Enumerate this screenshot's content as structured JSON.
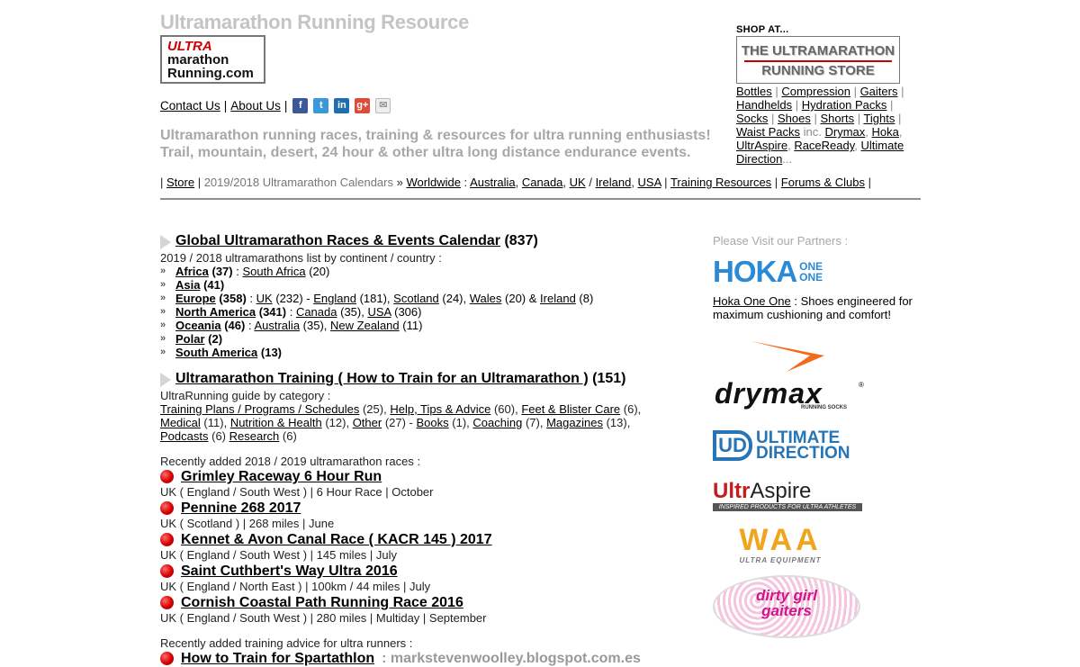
{
  "header": {
    "site_title": "Ultramarathon Running Resource",
    "logo": {
      "line1": "ULTRA",
      "line2": "marathon",
      "line3": "Running.com"
    },
    "contact": "Contact Us",
    "about": "About Us",
    "sep": "|",
    "social": {
      "fb": "f",
      "tw": "t",
      "li": "in",
      "gp": "g+",
      "em": "✉"
    },
    "tagline": "Ultramarathon running races, training & resources for ultra running enthusiasts! Trail, mountain, desert, 24 hour & other ultra long distance endurance events."
  },
  "nav": {
    "store": "Store",
    "calendars": "2019/2018 Ultramarathon Calendars",
    "worldwide": "Worldwide",
    "australia": "Australia",
    "canada": "Canada",
    "uk": "UK",
    "ireland": "Ireland",
    "usa": "USA",
    "training": "Training Resources",
    "forums": "Forums & Clubs"
  },
  "shop": {
    "label": "SHOP AT...",
    "store_line1": "THE ULTRAMARATHON",
    "store_line2": "RUNNING STORE",
    "links": [
      "Bottles",
      "Compression",
      "Gaiters",
      "Handhelds",
      "Hydration Packs",
      "Socks",
      "Shoes",
      "Shorts",
      "Tights",
      "Waist Packs"
    ],
    "inc": "inc.",
    "brands": [
      "Drymax",
      "Hoka",
      "UltrAspire",
      "RaceReady",
      "Ultimate Direction"
    ],
    "ellipsis": "..."
  },
  "calendar": {
    "title": "Global Ultramarathon Races & Events Calendar",
    "count": "(837)",
    "subtitle": "2019 / 2018 ultramarathons list by continent / country :",
    "continents": [
      {
        "name": "Africa",
        "count": "(37)",
        "rest": [
          {
            "t": "South Africa",
            "c": "(20)"
          }
        ]
      },
      {
        "name": "Asia",
        "count": "(41)",
        "rest": []
      },
      {
        "name": "Europe",
        "count": "(358)",
        "rest": [
          {
            "t": "UK",
            "c": "(232) -"
          },
          {
            "t": "England",
            "c": "(181),"
          },
          {
            "t": "Scotland",
            "c": "(24),"
          },
          {
            "t": "Wales",
            "c": "(20) &"
          },
          {
            "t": "Ireland",
            "c": "(8)"
          }
        ]
      },
      {
        "name": "North America",
        "count": "(341)",
        "rest": [
          {
            "t": "Canada",
            "c": "(35),"
          },
          {
            "t": "USA",
            "c": "(306)"
          }
        ]
      },
      {
        "name": "Oceania",
        "count": "(46)",
        "rest": [
          {
            "t": "Australia",
            "c": "(35),"
          },
          {
            "t": "New Zealand",
            "c": "(11)"
          }
        ]
      },
      {
        "name": "Polar",
        "count": "(2)",
        "rest": []
      },
      {
        "name": "South America",
        "count": "(13)",
        "rest": []
      }
    ]
  },
  "training": {
    "title": "Ultramarathon Training ( How to Train for an Ultramarathon )",
    "count": "(151)",
    "subtitle": "UltraRunning guide by category :",
    "cats": [
      {
        "t": "Training Plans / Programs / Schedules",
        "c": "(25),"
      },
      {
        "t": "Help, Tips & Advice",
        "c": "(60),"
      },
      {
        "t": "Feet & Blister Care",
        "c": "(6),"
      },
      {
        "t": "Medical",
        "c": "(11),"
      },
      {
        "t": "Nutrition & Health",
        "c": "(12),"
      },
      {
        "t": "Other",
        "c": "(27) -"
      },
      {
        "t": "Books",
        "c": "(1),"
      },
      {
        "t": "Coaching",
        "c": "(7),"
      },
      {
        "t": "Magazines",
        "c": "(13),"
      },
      {
        "t": "Podcasts",
        "c": "(6)"
      },
      {
        "t": "Research",
        "c": "(6)"
      }
    ]
  },
  "recent": {
    "label": "Recently added 2018 / 2019 ultramarathon races :",
    "races": [
      {
        "title": "Grimley Raceway 6 Hour Run",
        "meta": "UK ( England / South West ) | 6 Hour Race | October"
      },
      {
        "title": "Pennine 268 2017",
        "meta": "UK ( Scotland ) | 268 miles | June"
      },
      {
        "title": "Kennet & Avon Canal Race ( KACR 145 ) 2017",
        "meta": "UK ( England / South West ) | 145 miles | July"
      },
      {
        "title": "Saint Cuthbert's Way Ultra 2016",
        "meta": "UK ( England / North East ) | 100km / 44 miles | July"
      },
      {
        "title": "Cornish Coastal Path Running Race 2016",
        "meta": "UK ( England / South West ) | 280 miles | Multiday | September"
      }
    ],
    "advice_label": "Recently added training advice for ultra runners :",
    "advice_title": "How to Train for Spartathlon",
    "advice_domain": ":  markstevenwoolley.blogspot.com.es"
  },
  "partners": {
    "heading": "Please Visit our Partners :",
    "hoka_logo": "HOKA",
    "hoka_one1": "ONE",
    "hoka_one2": "ONE",
    "hoka_link": "Hoka One One",
    "hoka_desc": ": Shoes engineered for maximum cushioning and comfort!",
    "drymax": "drymax",
    "drymax_reg": "®",
    "drymax_sub": "RUNNING SOCKS",
    "ud_mark": "UD",
    "ud_line1": "ULTIMATE",
    "ud_line2": "DIRECTION",
    "ua_a": "Ultr",
    "ua_b": "Aspire",
    "ua_strip": "INSPIRED PRODUCTS FOR ULTRA ATHLETES",
    "waa": "WAA",
    "waa_sub": "ULTRA EQUIPMENT",
    "dgg_1": "dirty girl",
    "dgg_2": "gaiters"
  },
  "colors": {
    "title_grey": "#c4c4c4",
    "logo_red": "#cc0000",
    "hoka_blue": "#2b8ad6",
    "ud_blue": "#2575b7",
    "ultraspire_red": "#c81b1b",
    "waa_orange": "#f0a51c",
    "dgg_pink": "#d2148a"
  }
}
